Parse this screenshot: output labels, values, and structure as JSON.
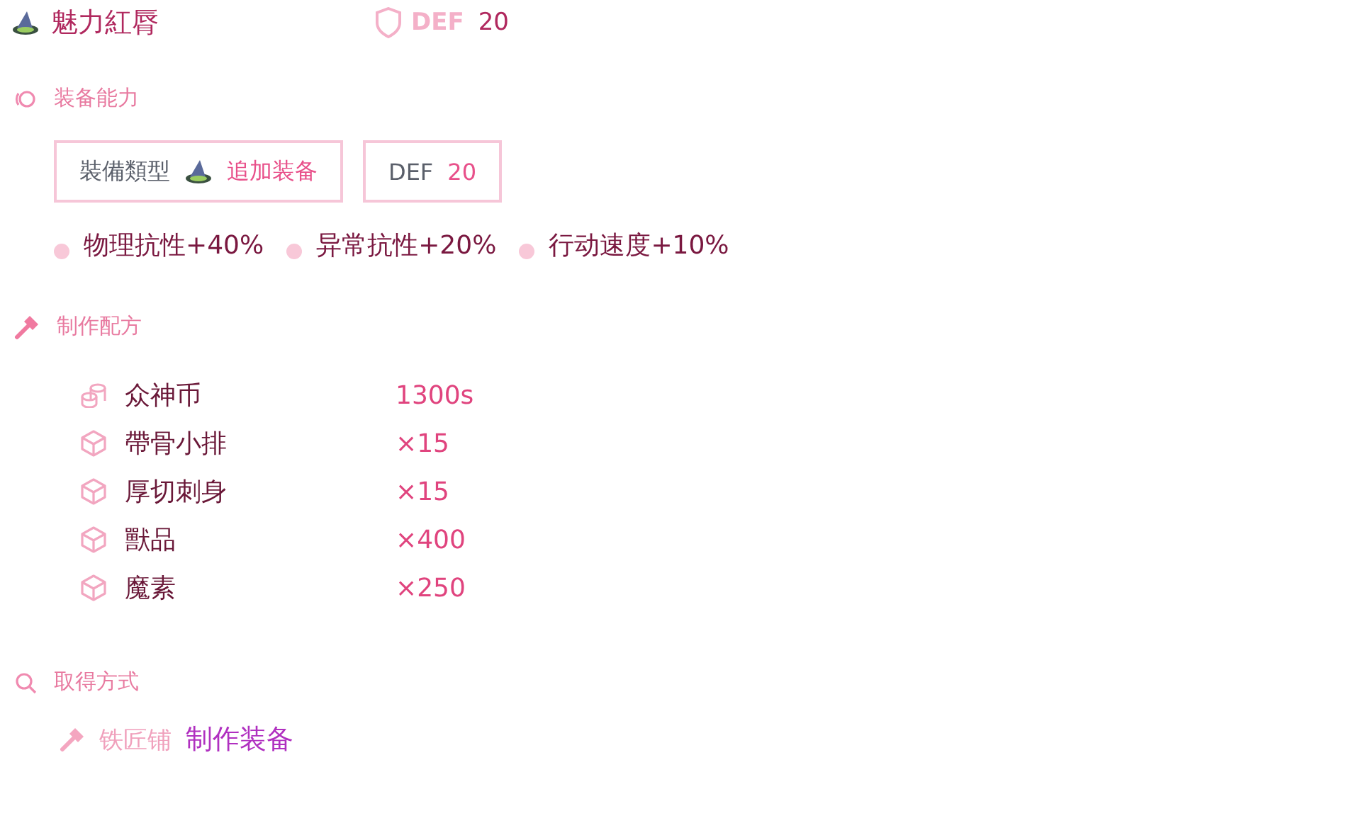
{
  "item": {
    "name": "魅力紅脣",
    "stat_label": "DEF",
    "stat_value": "20"
  },
  "abilities": {
    "title": "装备能力",
    "type_label": "裝備類型",
    "type_value": "追加装备",
    "stat_label": "DEF",
    "stat_value": "20",
    "effects": [
      "物理抗性+40%",
      "异常抗性+20%",
      "行动速度+10%"
    ]
  },
  "recipe": {
    "title": "制作配方",
    "materials": [
      {
        "kind": "coin",
        "name": "众神币",
        "amount": "1300s"
      },
      {
        "kind": "item",
        "name": "帶骨小排",
        "amount": "×15"
      },
      {
        "kind": "item",
        "name": "厚切刺身",
        "amount": "×15"
      },
      {
        "kind": "item",
        "name": "獸品",
        "amount": "×400"
      },
      {
        "kind": "item",
        "name": "魔素",
        "amount": "×250"
      }
    ]
  },
  "acquire": {
    "title": "取得方式",
    "source": "铁匠铺",
    "method": "制作装备"
  }
}
